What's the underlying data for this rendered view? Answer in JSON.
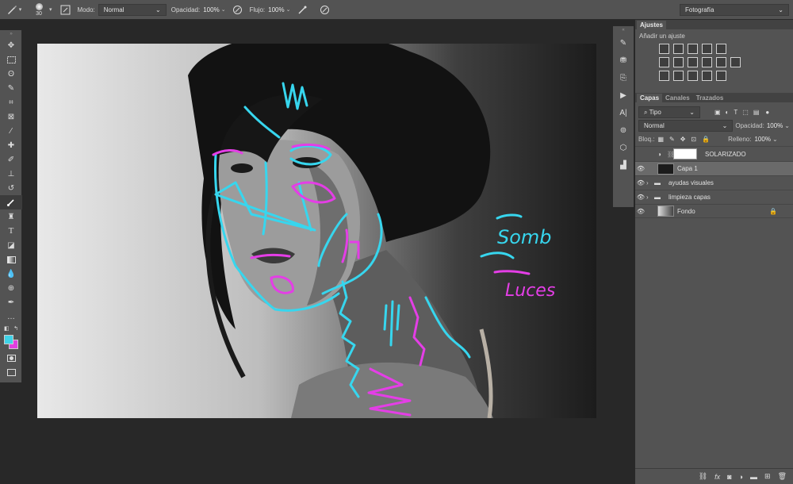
{
  "options_bar": {
    "brush_size": "30",
    "mode_label": "Modo:",
    "mode_value": "Normal",
    "opacity_label": "Opacidad:",
    "opacity_value": "100%",
    "flow_label": "Flujo:",
    "flow_value": "100%",
    "workspace": "Fotografía"
  },
  "colors": {
    "foreground": "#3fd3e8",
    "background": "#e040e0",
    "cyan_stroke": "#37d6ee",
    "magenta_stroke": "#e43ee6"
  },
  "adjustments": {
    "title": "Ajustes",
    "subtitle": "Añadir un ajuste"
  },
  "layers_panel": {
    "tabs": [
      "Capas",
      "Canales",
      "Trazados"
    ],
    "filter_kind": "Tipo",
    "blend_mode": "Normal",
    "opacity_label": "Opacidad:",
    "opacity_value": "100%",
    "lock_label": "Bloq.:",
    "fill_label": "Relleno:",
    "fill_value": "100%",
    "layers": [
      {
        "name": "SOLARIZADO",
        "type": "adjustment"
      },
      {
        "name": "Capa 1",
        "type": "pixel",
        "selected": true
      },
      {
        "name": "ayudas visuales",
        "type": "group"
      },
      {
        "name": "limpieza capas",
        "type": "group"
      },
      {
        "name": "Fondo",
        "type": "background",
        "locked": true
      }
    ]
  },
  "canvas_annotations": {
    "shadows": "Somb",
    "lights": "Luces"
  }
}
